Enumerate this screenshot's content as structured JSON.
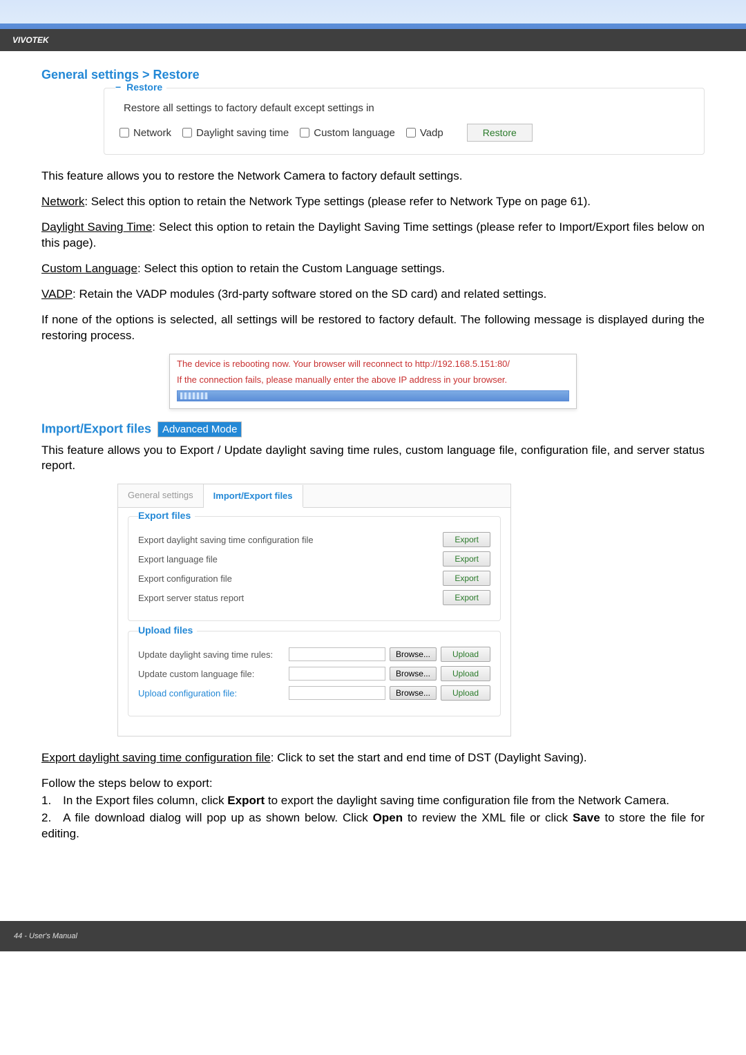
{
  "header": {
    "brand": "VIVOTEK"
  },
  "section_restore": {
    "title": "General settings > Restore",
    "legend": "Restore",
    "desc": "Restore all settings to factory default except settings in",
    "chk_network": "Network",
    "chk_dst": "Daylight saving time",
    "chk_lang": "Custom language",
    "chk_vadp": "Vadp",
    "btn": "Restore"
  },
  "paras": {
    "p1": "This feature allows you to restore the Network Camera to factory default settings.",
    "p2_label": "Network",
    "p2_rest": ": Select this option to retain the Network Type settings (please refer to Network Type on page 61).",
    "p3_label": "Daylight Saving Time",
    "p3_rest": ": Select this option to retain the Daylight Saving Time settings (please refer to Import/Export files below on this page).",
    "p4_label": "Custom Language",
    "p4_rest": ": Select this option to retain the Custom Language settings.",
    "p5_label": "VADP",
    "p5_rest": ": Retain the VADP modules (3rd-party software stored on the SD card) and related settings.",
    "p6": "If none of the options is selected, all settings will be restored to factory default. The following message is displayed during the restoring process."
  },
  "reboot": {
    "line1": "The device is rebooting now. Your browser will reconnect to http://192.168.5.151:80/",
    "line2": "If the connection fails, please manually enter the above IP address in your browser."
  },
  "section_ie": {
    "title": "Import/Export files",
    "badge": "Advanced Mode",
    "intro": "This feature allows you to Export / Update daylight saving time rules, custom language file, configuration file, and server status report.",
    "tabs": {
      "general": "General settings",
      "ie": "Import/Export files"
    },
    "export": {
      "legend": "Export files",
      "rows": [
        "Export daylight saving time configuration file",
        "Export language file",
        "Export configuration file",
        "Export server status report"
      ],
      "btn": "Export"
    },
    "upload": {
      "legend": "Upload files",
      "rows": [
        "Update daylight saving time rules:",
        "Update custom language file:",
        "Upload configuration file:"
      ],
      "browse": "Browse...",
      "upload_btn": "Upload"
    }
  },
  "para2": {
    "p1_label": "Export daylight saving time configuration file",
    "p1_rest": ": Click to set the start and end time of DST (Daylight Saving).",
    "p2": "Follow the steps below to export:",
    "li1_a": "1. In the Export files column, click ",
    "li1_bold": "Export",
    "li1_b": " to export the daylight saving time configuration file from the Network Camera.",
    "li2_a": "2. A file download dialog will pop up as shown below. Click ",
    "li2_open": "Open",
    "li2_mid": " to review the XML file or click ",
    "li2_save": "Save",
    "li2_end": " to store the file for editing."
  },
  "footer": {
    "text": "44 - User's Manual"
  }
}
